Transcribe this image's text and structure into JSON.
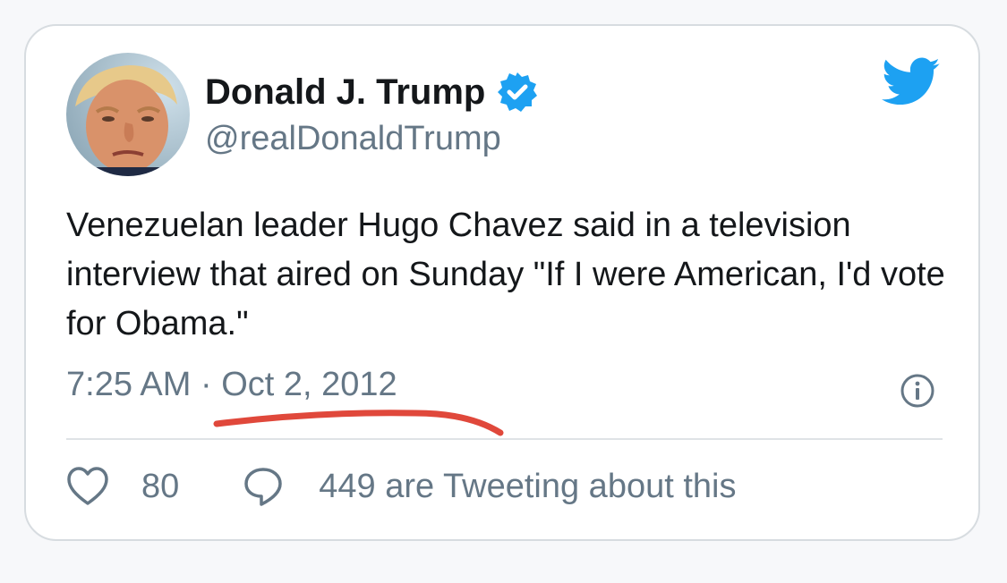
{
  "author": {
    "name": "Donald J. Trump",
    "handle": "@realDonaldTrump",
    "verified": true
  },
  "tweet": {
    "text": "Venezuelan leader Hugo Chavez said in a television interview that aired on Sunday \"If I were American, I'd vote for Obama.\"",
    "time": "7:25 AM",
    "separator": "·",
    "date": "Oct 2, 2012"
  },
  "actions": {
    "likes": "80",
    "tweeting": "449 are Tweeting about this"
  },
  "icons": {
    "brand": "twitter-bird-icon",
    "verified": "verified-badge-icon",
    "info": "info-icon",
    "like": "heart-icon",
    "reply": "speech-bubble-icon"
  },
  "colors": {
    "twitter_blue": "#1da1f2",
    "text_primary": "#14171a",
    "text_secondary": "#657786",
    "annotation_red": "#e0483b"
  }
}
